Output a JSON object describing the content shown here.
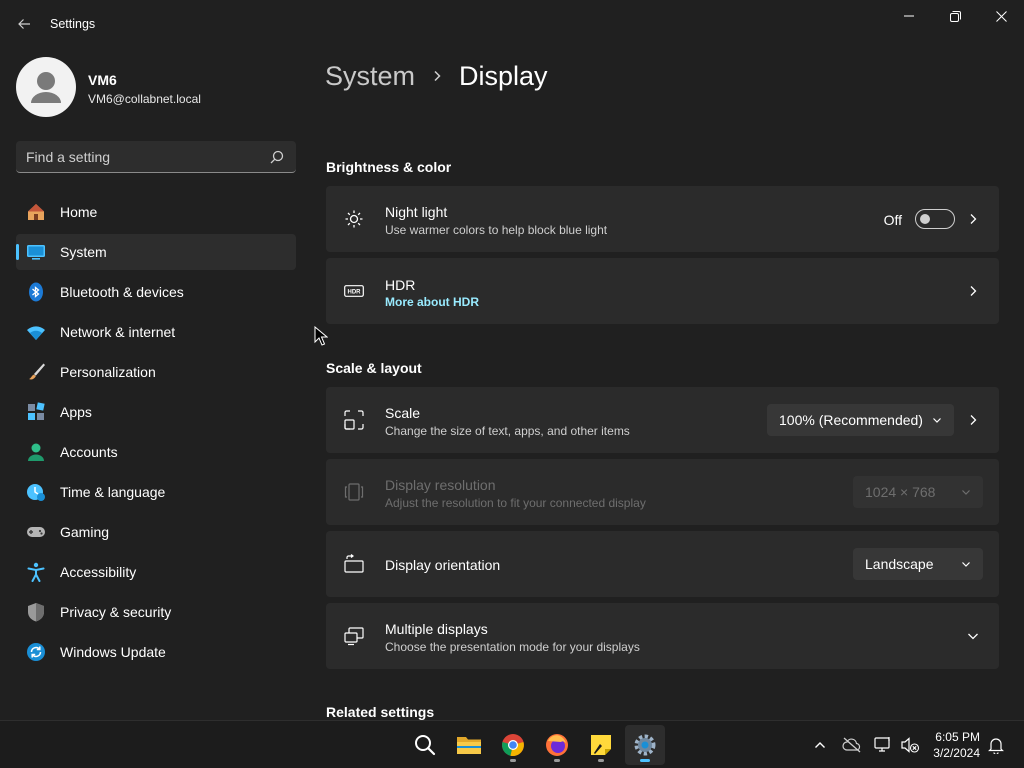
{
  "window": {
    "title": "Settings",
    "buttons": [
      "minimize",
      "restore",
      "close"
    ]
  },
  "profile": {
    "name": "VM6",
    "email": "VM6@collabnet.local"
  },
  "search": {
    "placeholder": "Find a setting"
  },
  "sidebar": {
    "items": [
      {
        "label": "Home",
        "icon": "home-icon",
        "selected": false
      },
      {
        "label": "System",
        "icon": "system-icon",
        "selected": true
      },
      {
        "label": "Bluetooth & devices",
        "icon": "bluetooth-icon",
        "selected": false
      },
      {
        "label": "Network & internet",
        "icon": "wifi-icon",
        "selected": false
      },
      {
        "label": "Personalization",
        "icon": "brush-icon",
        "selected": false
      },
      {
        "label": "Apps",
        "icon": "apps-icon",
        "selected": false
      },
      {
        "label": "Accounts",
        "icon": "accounts-icon",
        "selected": false
      },
      {
        "label": "Time & language",
        "icon": "time-language-icon",
        "selected": false
      },
      {
        "label": "Gaming",
        "icon": "gamepad-icon",
        "selected": false
      },
      {
        "label": "Accessibility",
        "icon": "accessibility-icon",
        "selected": false
      },
      {
        "label": "Privacy & security",
        "icon": "shield-icon",
        "selected": false
      },
      {
        "label": "Windows Update",
        "icon": "update-icon",
        "selected": false
      }
    ]
  },
  "breadcrumb": {
    "parent": "System",
    "current": "Display"
  },
  "sections": {
    "brightness": "Brightness & color",
    "scale_layout": "Scale & layout",
    "related": "Related settings"
  },
  "night_light": {
    "title": "Night light",
    "subtitle": "Use warmer colors to help block blue light",
    "state": "Off"
  },
  "hdr": {
    "title": "HDR",
    "link": "More about HDR"
  },
  "scale": {
    "title": "Scale",
    "subtitle": "Change the size of text, apps, and other items",
    "value": "100% (Recommended)"
  },
  "resolution": {
    "title": "Display resolution",
    "subtitle": "Adjust the resolution to fit your connected display",
    "value": "1024 × 768",
    "disabled": true
  },
  "orientation": {
    "title": "Display orientation",
    "value": "Landscape"
  },
  "multiple": {
    "title": "Multiple displays",
    "subtitle": "Choose the presentation mode for your displays"
  },
  "taskbar": {
    "apps": [
      "search-icon",
      "file-explorer-icon",
      "chrome-icon",
      "firefox-icon",
      "sticky-notes-icon",
      "settings-icon"
    ],
    "time": "6:05 PM",
    "date": "3/2/2024"
  },
  "colors": {
    "accent": "#4cc2ff",
    "link": "#99ebff",
    "background": "#202020",
    "card": "#2b2b2b"
  }
}
